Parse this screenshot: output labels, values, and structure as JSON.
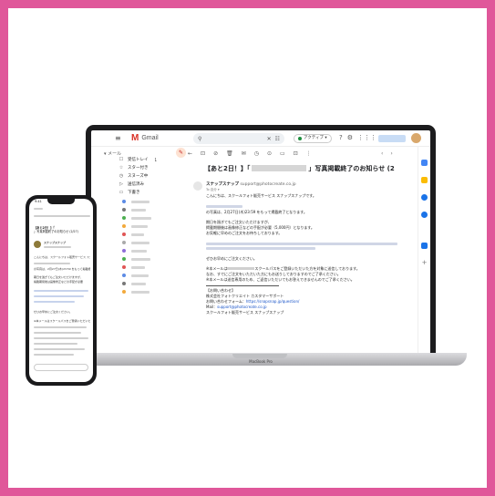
{
  "gmail": {
    "logo_m": "M",
    "logo_text": "Gmail",
    "search_icon": "search-icon",
    "search_close": "✕",
    "search_filter": "☷",
    "active_status": "アクティブ ▾",
    "header_icons": [
      "?",
      "⚙",
      "⋮⋮⋮"
    ],
    "menu_glyph": "≡",
    "compose_label": "▾ メール",
    "sidebar": [
      {
        "icon": "☐",
        "label": "受信トレイ",
        "count": "1"
      },
      {
        "icon": "☆",
        "label": "スター付き",
        "count": ""
      },
      {
        "icon": "◷",
        "label": "スヌーズ中",
        "count": ""
      },
      {
        "icon": "▷",
        "label": "送信済み",
        "count": ""
      },
      {
        "icon": "▭",
        "label": "下書き",
        "count": ""
      }
    ],
    "edit_glyph": "✎",
    "toolbar": [
      "←",
      "⊡",
      "⊘",
      "🗑",
      "✉",
      "◷",
      "⊙",
      "▭",
      "⊡",
      "⋮"
    ],
    "pager": [
      "‹",
      "›"
    ],
    "subject_prefix": "【あと2日！】「",
    "subject_suffix": "」写真掲載終了のお知らせ (2",
    "sender_name": "スナップスナップ",
    "sender_addr": "support@photocreate.co.jp",
    "to_line": "To 自分 ▾",
    "body": {
      "greeting": "こんにちは、スクールフォト販売サービス スナップスナップです。",
      "line2": "の写真は、2月27日(木)23:59 をもって掲載終了となります。",
      "line3": "期日を過ぎてもご注文いただけますが、",
      "line4": "掲載期間後は画像修正などの手配が必要（5,000円）となります。",
      "line5": "お気軽に早めのご注文をお待ちしております。",
      "line6": "ぜひお早めにご注文ください。",
      "line7": "※本メールは",
      "line7b": "スクールパスをご登録いただいた方を対象に送信しております。",
      "line8": "なお、すでにご注文をいただいた方にもお送りしておりますのでご了承ください。",
      "line9": "※本メールは送信専用のため、ご返信いただいてもお答えできませんのでご了承ください。",
      "sig1": "【お問い合わせ】",
      "sig2": "株式会社フォトクリエイト カスタマーサポート",
      "sig3": "お問い合わせフォーム：",
      "sig3_link": "https://snapsnap.jp/question/",
      "sig4": "Mail：",
      "sig4_link": "support@photocreate.co.jp",
      "sig5": "スクールフォト販売サービス スナップスナップ"
    }
  },
  "laptop_label": "MacBook Pro",
  "phone": {
    "status": "9:41",
    "title_prefix": "【あと2日！】「",
    "title_line2": "」写真掲載終了のお知らせ (2/27)",
    "sender": "スナップスナップ",
    "greeting": "こんにちは、スクールフォト販売サービス スナップスナップです。",
    "l1": "の写真は、2月27日(木)23:59 をもって掲載終了となります。",
    "l2": "期日を過ぎてもご注文いただけますが、",
    "l3": "掲載期間後は画像修正などの手配が必要",
    "l4": "ぜひお早めにご注文ください。",
    "l5": "※本メールはスクールパスをご登録いただいた方を対象に送信しております。"
  },
  "colors": {
    "frame": "#e0579a",
    "gmail_red": "#d93025",
    "link": "#1a55c9"
  }
}
